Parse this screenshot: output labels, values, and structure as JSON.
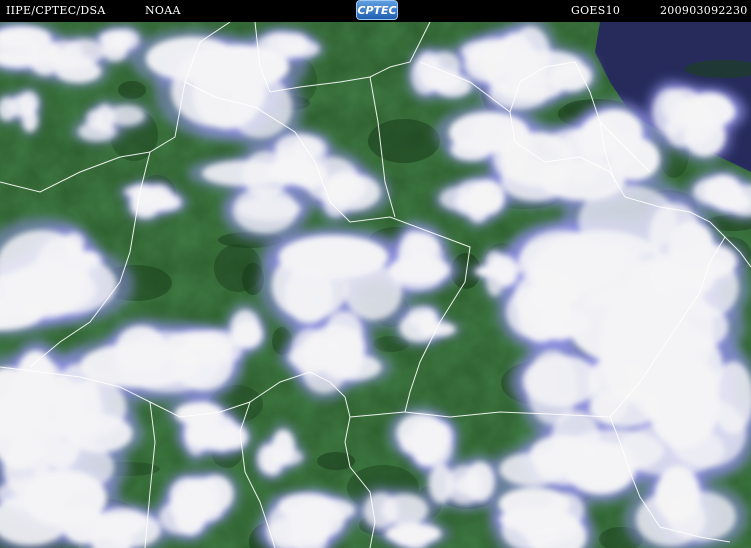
{
  "header": {
    "agency": "IIPE/CPTEC/DSA",
    "partner": "NOAA",
    "logo_text": "CPTEC",
    "satellite": "GOES10",
    "timestamp": "200903092230"
  },
  "colors": {
    "header_background": "#000000",
    "header_text": "#ffffff",
    "vegetation": "#2c5c2c",
    "clear_sky_ocean": "#262b5c",
    "cloud_white": "#f4f4f6",
    "cloud_fringe": "#9090e6",
    "boundary_lines": "#ffffff"
  },
  "map": {
    "type": "satellite-imagery",
    "product": "visible-infrared composite",
    "borders": "state and country boundary lines"
  }
}
